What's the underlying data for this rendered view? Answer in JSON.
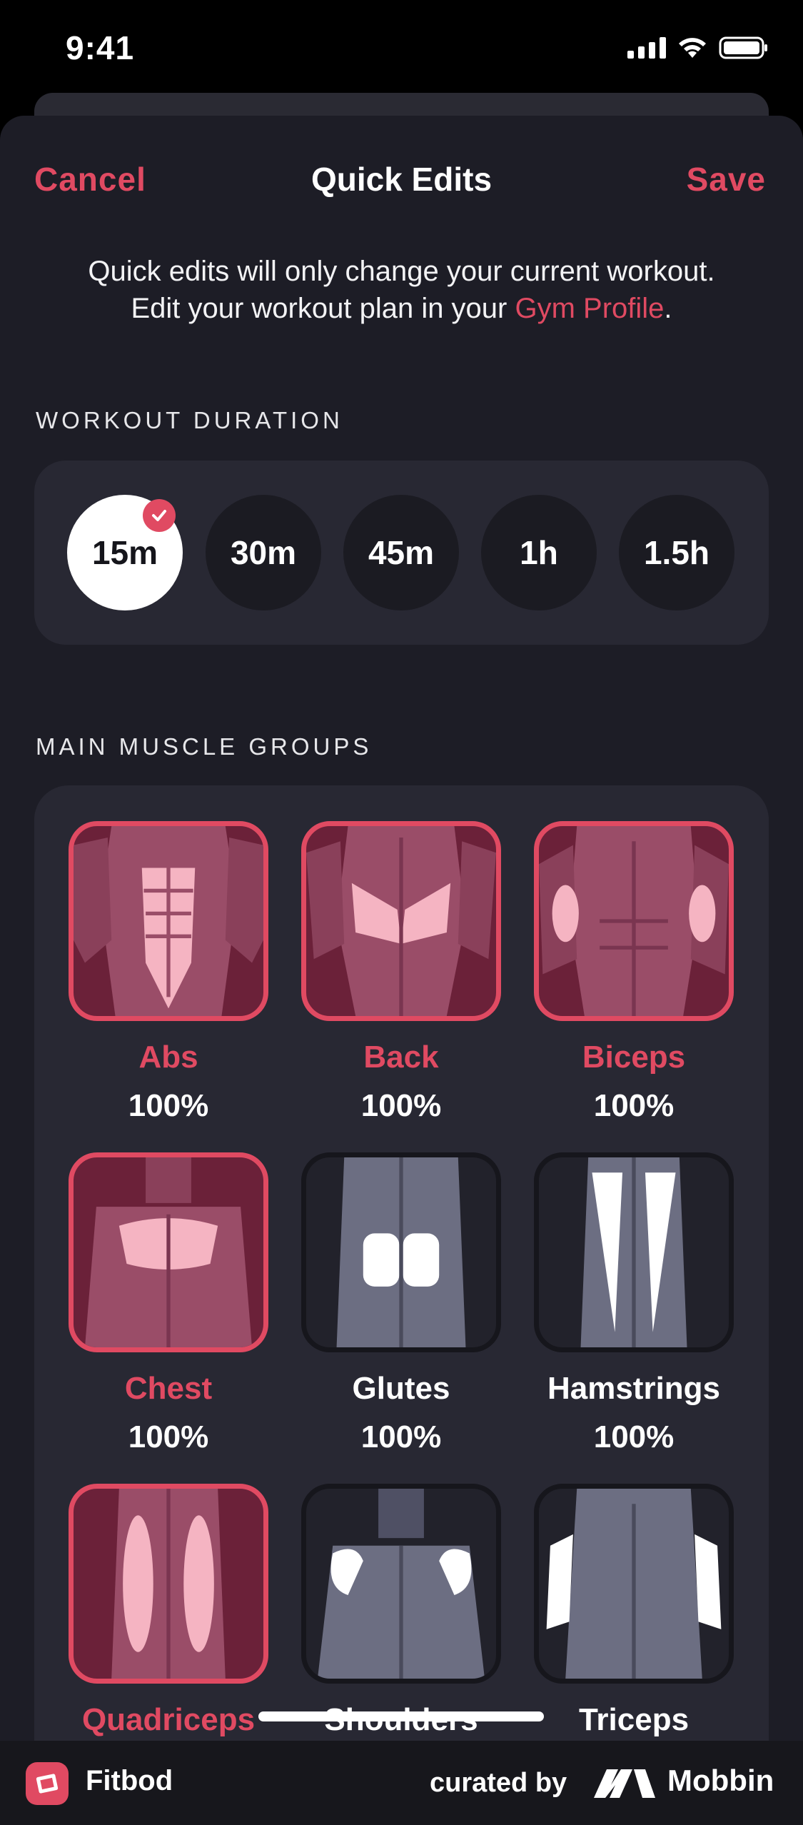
{
  "status_bar": {
    "time": "9:41",
    "icons": [
      "cellular-signal-icon",
      "wifi-icon",
      "battery-icon"
    ]
  },
  "nav": {
    "cancel_label": "Cancel",
    "title": "Quick Edits",
    "save_label": "Save"
  },
  "info": {
    "line1": "Quick edits will only change your current workout.",
    "line2_prefix": "Edit your workout plan in your ",
    "line2_link": "Gym Profile",
    "line2_suffix": "."
  },
  "workout_duration": {
    "heading": "WORKOUT DURATION",
    "options": [
      {
        "label": "15m",
        "selected": true
      },
      {
        "label": "30m",
        "selected": false
      },
      {
        "label": "45m",
        "selected": false
      },
      {
        "label": "1h",
        "selected": false
      },
      {
        "label": "1.5h",
        "selected": false
      }
    ]
  },
  "muscle_groups": {
    "heading": "MAIN MUSCLE GROUPS",
    "items": [
      {
        "name": "Abs",
        "percent": "100%",
        "selected": true,
        "icon": "abs-muscle-icon"
      },
      {
        "name": "Back",
        "percent": "100%",
        "selected": true,
        "icon": "back-muscle-icon"
      },
      {
        "name": "Biceps",
        "percent": "100%",
        "selected": true,
        "icon": "biceps-muscle-icon"
      },
      {
        "name": "Chest",
        "percent": "100%",
        "selected": true,
        "icon": "chest-muscle-icon"
      },
      {
        "name": "Glutes",
        "percent": "100%",
        "selected": false,
        "icon": "glutes-muscle-icon"
      },
      {
        "name": "Hamstrings",
        "percent": "100%",
        "selected": false,
        "icon": "hamstrings-muscle-icon"
      },
      {
        "name": "Quadriceps",
        "percent": "",
        "selected": true,
        "icon": "quadriceps-muscle-icon"
      },
      {
        "name": "Shoulders",
        "percent": "",
        "selected": false,
        "icon": "shoulders-muscle-icon"
      },
      {
        "name": "Triceps",
        "percent": "",
        "selected": false,
        "icon": "triceps-muscle-icon"
      }
    ]
  },
  "footer": {
    "app_name": "Fitbod",
    "curated_by": "curated by",
    "brand": "Mobbin"
  },
  "colors": {
    "accent": "#e04a62",
    "sheet_background": "#1d1d26",
    "card_background": "#282833",
    "selected_tile": "#6b2139"
  }
}
